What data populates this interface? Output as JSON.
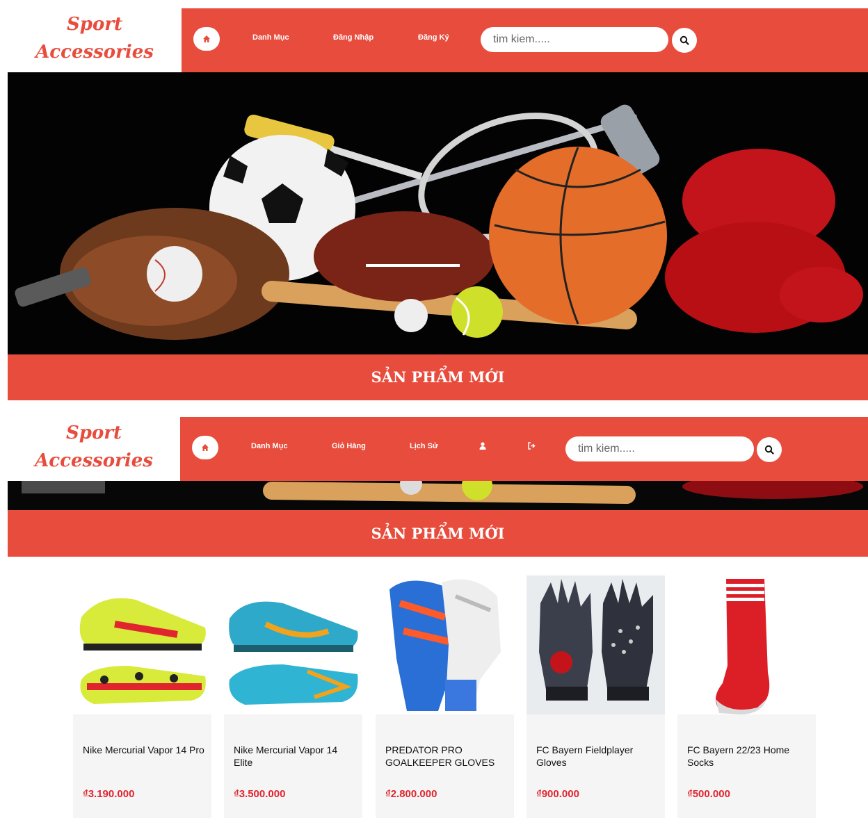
{
  "colors": {
    "brand": "#e84c3d",
    "price": "#e0252f",
    "text": "#111111"
  },
  "guest_view": {
    "logo": {
      "line1": "Sport",
      "line2": "Accessories"
    },
    "nav": {
      "home_icon": "home-icon",
      "items": [
        "Danh Mục",
        "Đăng Nhập",
        "Đăng Ký"
      ]
    },
    "search": {
      "placeholder": "tim kiem.....",
      "icon": "search-icon"
    },
    "section_title": "SẢN PHẨM MỚI"
  },
  "user_view": {
    "logo": {
      "line1": "Sport",
      "line2": "Accessories"
    },
    "nav": {
      "home_icon": "home-icon",
      "items": [
        "Danh Mục",
        "Giỏ Hàng",
        "Lịch Sử"
      ],
      "icons": [
        "user-icon",
        "sign-out-icon"
      ]
    },
    "search": {
      "placeholder": "tim kiem.....",
      "icon": "search-icon"
    },
    "section_title": "SẢN PHẨM MỚI",
    "products": [
      {
        "name": "Nike Mercurial Vapor 14 Pro",
        "price": "₫3.190.000"
      },
      {
        "name": "Nike Mercurial Vapor 14 Elite",
        "price": "₫3.500.000"
      },
      {
        "name": "PREDATOR PRO GOALKEEPER GLOVES",
        "price": "₫2.800.000"
      },
      {
        "name": "FC Bayern Fieldplayer Gloves",
        "price": "₫900.000"
      },
      {
        "name": "FC Bayern 22/23 Home Socks",
        "price": "₫500.000"
      }
    ]
  }
}
